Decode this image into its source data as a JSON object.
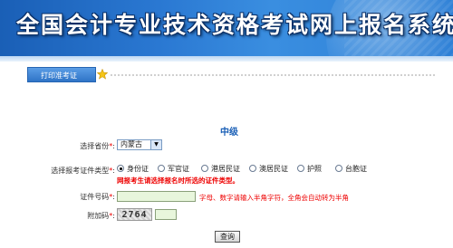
{
  "header": {
    "title": "全国会计专业技术资格考试网上报名系统"
  },
  "tabs": [
    {
      "label": "打印准考证"
    }
  ],
  "form": {
    "level": "中级",
    "province_label": "选择省份",
    "province_value": "内蒙古",
    "required_mark": "*",
    "colon": ":",
    "id_type_label": "选择报考证件类型",
    "id_types": [
      "身份证",
      "军官证",
      "港居民证",
      "澳居民证",
      "护照",
      "台胞证"
    ],
    "id_type_selected": 0,
    "id_type_warning": "网报考生请选择报名时所选的证件类型。",
    "id_number_label": "证件号码",
    "id_number_value": "",
    "id_number_hint": "字母、数字请输入半角字符，全角会自动转为半角",
    "captcha_label": "附加码",
    "captcha_code": "2764",
    "captcha_value": "",
    "submit_label": "查询"
  },
  "colors": {
    "banner": "#2a78d2",
    "warning": "#e00000",
    "level_text": "#1a5fb6",
    "input_bg": "#e8f6dc"
  }
}
